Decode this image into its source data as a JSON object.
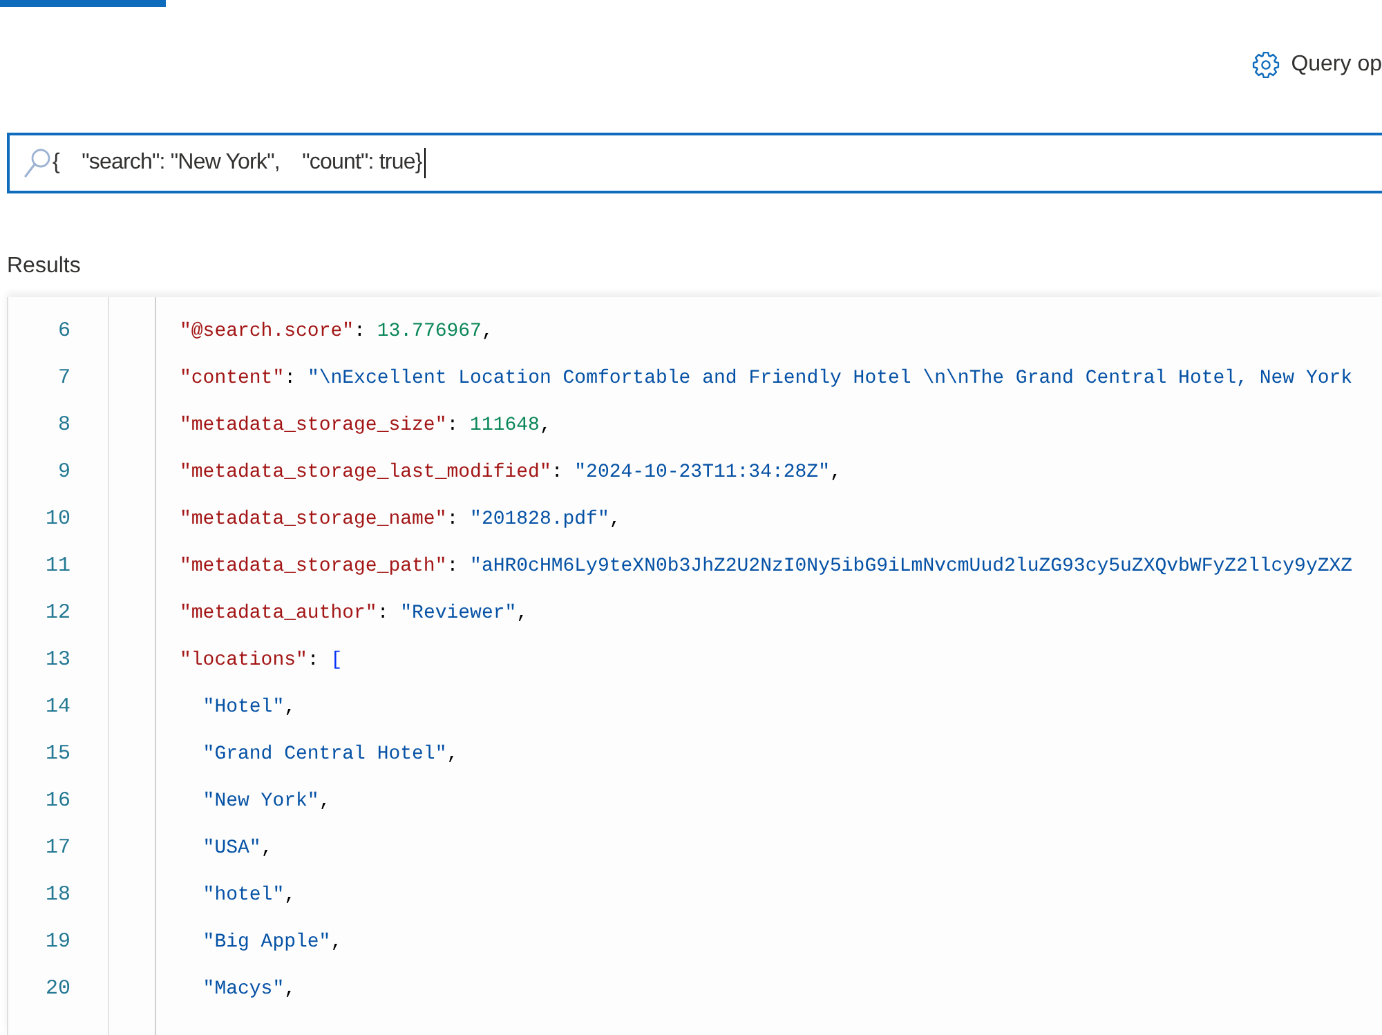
{
  "top_tab": {
    "selected": true
  },
  "toolbar": {
    "query_options": {
      "label": "Query op"
    }
  },
  "search": {
    "value": "{    \"search\": \"New York\",    \"count\": true}",
    "focused": true
  },
  "results": {
    "label": "Results",
    "lines": [
      {
        "number": "6",
        "tokens": [
          {
            "kind": "key",
            "text": "\"@search.score\""
          },
          {
            "kind": "punct",
            "text": ": "
          },
          {
            "kind": "number",
            "text": "13.776967"
          },
          {
            "kind": "punct",
            "text": ","
          }
        ]
      },
      {
        "number": "7",
        "tokens": [
          {
            "kind": "key",
            "text": "\"content\""
          },
          {
            "kind": "punct",
            "text": ": "
          },
          {
            "kind": "string",
            "text": "\"\\nExcellent Location Comfortable and Friendly Hotel \\n\\nThe Grand Central Hotel, New York"
          }
        ]
      },
      {
        "number": "8",
        "tokens": [
          {
            "kind": "key",
            "text": "\"metadata_storage_size\""
          },
          {
            "kind": "punct",
            "text": ": "
          },
          {
            "kind": "number",
            "text": "111648"
          },
          {
            "kind": "punct",
            "text": ","
          }
        ]
      },
      {
        "number": "9",
        "tokens": [
          {
            "kind": "key",
            "text": "\"metadata_storage_last_modified\""
          },
          {
            "kind": "punct",
            "text": ": "
          },
          {
            "kind": "string",
            "text": "\"2024-10-23T11:34:28Z\""
          },
          {
            "kind": "punct",
            "text": ","
          }
        ]
      },
      {
        "number": "10",
        "tokens": [
          {
            "kind": "key",
            "text": "\"metadata_storage_name\""
          },
          {
            "kind": "punct",
            "text": ": "
          },
          {
            "kind": "string",
            "text": "\"201828.pdf\""
          },
          {
            "kind": "punct",
            "text": ","
          }
        ]
      },
      {
        "number": "11",
        "tokens": [
          {
            "kind": "key",
            "text": "\"metadata_storage_path\""
          },
          {
            "kind": "punct",
            "text": ": "
          },
          {
            "kind": "string",
            "text": "\"aHR0cHM6Ly9teXN0b3JhZ2U2NzI0Ny5ibG9iLmNvcmUud2luZG93cy5uZXQvbWFyZ2llcy9yZXZ"
          }
        ]
      },
      {
        "number": "12",
        "tokens": [
          {
            "kind": "key",
            "text": "\"metadata_author\""
          },
          {
            "kind": "punct",
            "text": ": "
          },
          {
            "kind": "string",
            "text": "\"Reviewer\""
          },
          {
            "kind": "punct",
            "text": ","
          }
        ]
      },
      {
        "number": "13",
        "tokens": [
          {
            "kind": "key",
            "text": "\"locations\""
          },
          {
            "kind": "punct",
            "text": ": "
          },
          {
            "kind": "bracket",
            "text": "["
          }
        ],
        "children": [
          {
            "number": "14",
            "tokens": [
              {
                "kind": "string",
                "text": "\"Hotel\""
              },
              {
                "kind": "punct",
                "text": ","
              }
            ]
          },
          {
            "number": "15",
            "tokens": [
              {
                "kind": "string",
                "text": "\"Grand Central Hotel\""
              },
              {
                "kind": "punct",
                "text": ","
              }
            ]
          },
          {
            "number": "16",
            "tokens": [
              {
                "kind": "string",
                "text": "\"New York\""
              },
              {
                "kind": "punct",
                "text": ","
              }
            ]
          },
          {
            "number": "17",
            "tokens": [
              {
                "kind": "string",
                "text": "\"USA\""
              },
              {
                "kind": "punct",
                "text": ","
              }
            ]
          },
          {
            "number": "18",
            "tokens": [
              {
                "kind": "string",
                "text": "\"hotel\""
              },
              {
                "kind": "punct",
                "text": ","
              }
            ]
          },
          {
            "number": "19",
            "tokens": [
              {
                "kind": "string",
                "text": "\"Big Apple\""
              },
              {
                "kind": "punct",
                "text": ","
              }
            ]
          },
          {
            "number": "20",
            "tokens": [
              {
                "kind": "string",
                "text": "\"Macys\""
              },
              {
                "kind": "punct",
                "text": ","
              }
            ]
          }
        ]
      }
    ]
  }
}
